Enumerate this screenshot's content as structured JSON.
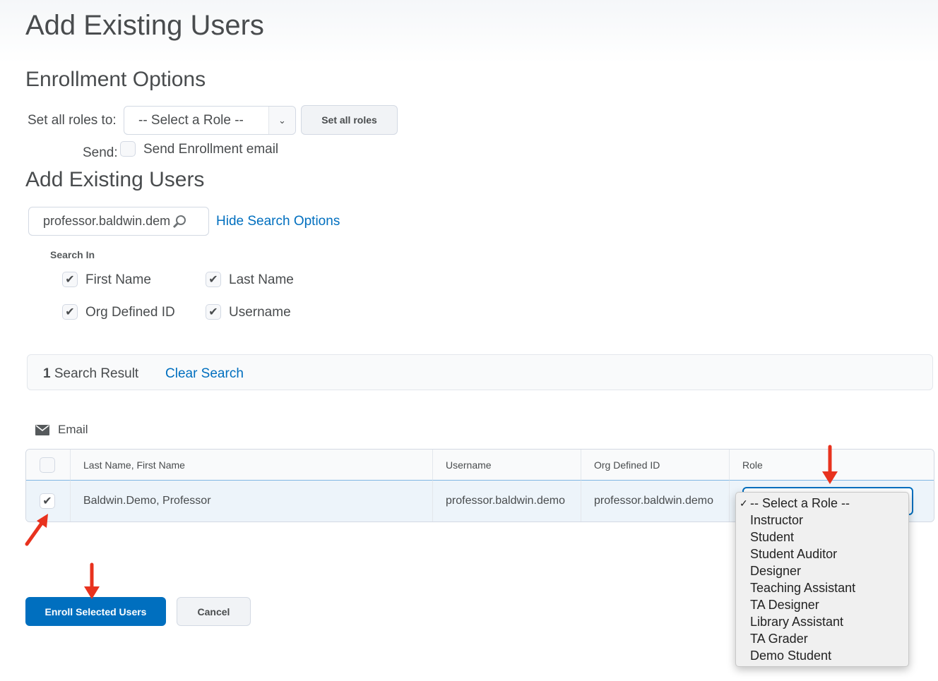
{
  "page": {
    "title": "Add Existing Users"
  },
  "enrollment": {
    "heading": "Enrollment Options",
    "set_roles_label": "Set all roles to:",
    "role_select": "-- Select a Role --",
    "set_all_button": "Set all roles",
    "send_label": "Send:",
    "send_email_label": "Send Enrollment email"
  },
  "search": {
    "heading": "Add Existing Users",
    "value": "professor.baldwin.dem",
    "toggle_link": "Hide Search Options",
    "search_in_label": "Search In",
    "fields": [
      {
        "label": "First Name",
        "checked": true
      },
      {
        "label": "Last Name",
        "checked": true
      },
      {
        "label": "Org Defined ID",
        "checked": true
      },
      {
        "label": "Username",
        "checked": true
      }
    ]
  },
  "results": {
    "count": "1",
    "count_label": "Search Result",
    "clear_link": "Clear Search",
    "email_label": "Email"
  },
  "table": {
    "columns": [
      "Last Name, First Name",
      "Username",
      "Org Defined ID",
      "Role"
    ],
    "rows": [
      {
        "name": "Baldwin.Demo, Professor",
        "username": "professor.baldwin.demo",
        "org_id": "professor.baldwin.demo",
        "selected": true
      }
    ]
  },
  "role_dropdown": {
    "selected": "-- Select a Role --",
    "options": [
      "-- Select a Role --",
      "Instructor",
      "Student",
      "Student Auditor",
      "Designer",
      "Teaching Assistant",
      "TA Designer",
      "Library Assistant",
      "TA Grader",
      "Demo Student"
    ]
  },
  "actions": {
    "enroll": "Enroll Selected Users",
    "cancel": "Cancel"
  },
  "colors": {
    "primary": "#006fbf",
    "annotation_arrow": "#e8321e"
  }
}
